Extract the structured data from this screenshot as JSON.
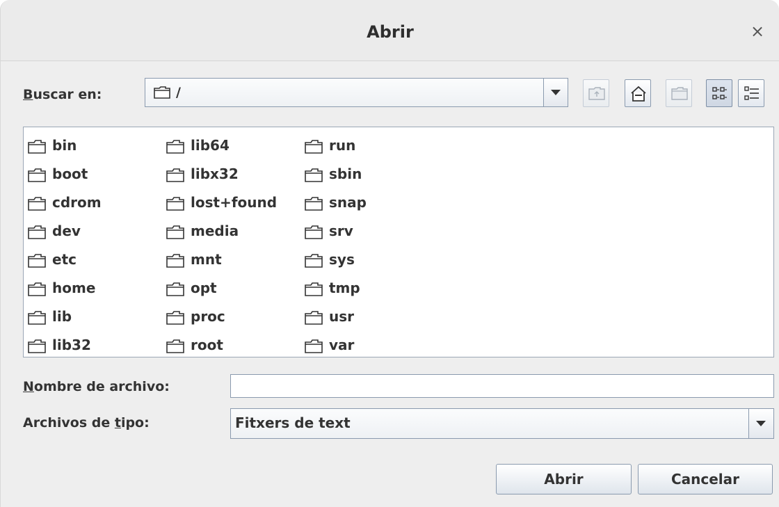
{
  "window": {
    "title": "Abrir",
    "close_glyph": "×"
  },
  "look_in": {
    "label_u": "B",
    "label_rest": "uscar en:",
    "value": "/",
    "icon": "folder-icon"
  },
  "toolbar": {
    "buttons": [
      {
        "name": "up-one-level-icon",
        "enabled": false
      },
      {
        "name": "home-icon",
        "enabled": true
      },
      {
        "name": "new-folder-icon",
        "enabled": false
      },
      {
        "name": "list-view-icon",
        "enabled": true,
        "pressed": true
      },
      {
        "name": "details-view-icon",
        "enabled": true
      }
    ]
  },
  "files": {
    "col1": [
      "bin",
      "boot",
      "cdrom",
      "dev",
      "etc",
      "home",
      "lib",
      "lib32"
    ],
    "col2": [
      "lib64",
      "libx32",
      "lost+found",
      "media",
      "mnt",
      "opt",
      "proc",
      "root"
    ],
    "col3": [
      "run",
      "sbin",
      "snap",
      "srv",
      "sys",
      "tmp",
      "usr",
      "var"
    ]
  },
  "file_name": {
    "label_u": "N",
    "label_rest": "ombre de archivo:",
    "value": ""
  },
  "file_type": {
    "label_pre": "Archivos de ",
    "label_u": "t",
    "label_rest": "ipo:",
    "value": "Fitxers de text"
  },
  "buttons": {
    "open": "Abrir",
    "cancel": "Cancelar"
  },
  "colors": {
    "border": "#8a9aae",
    "background": "#eeeeee"
  }
}
